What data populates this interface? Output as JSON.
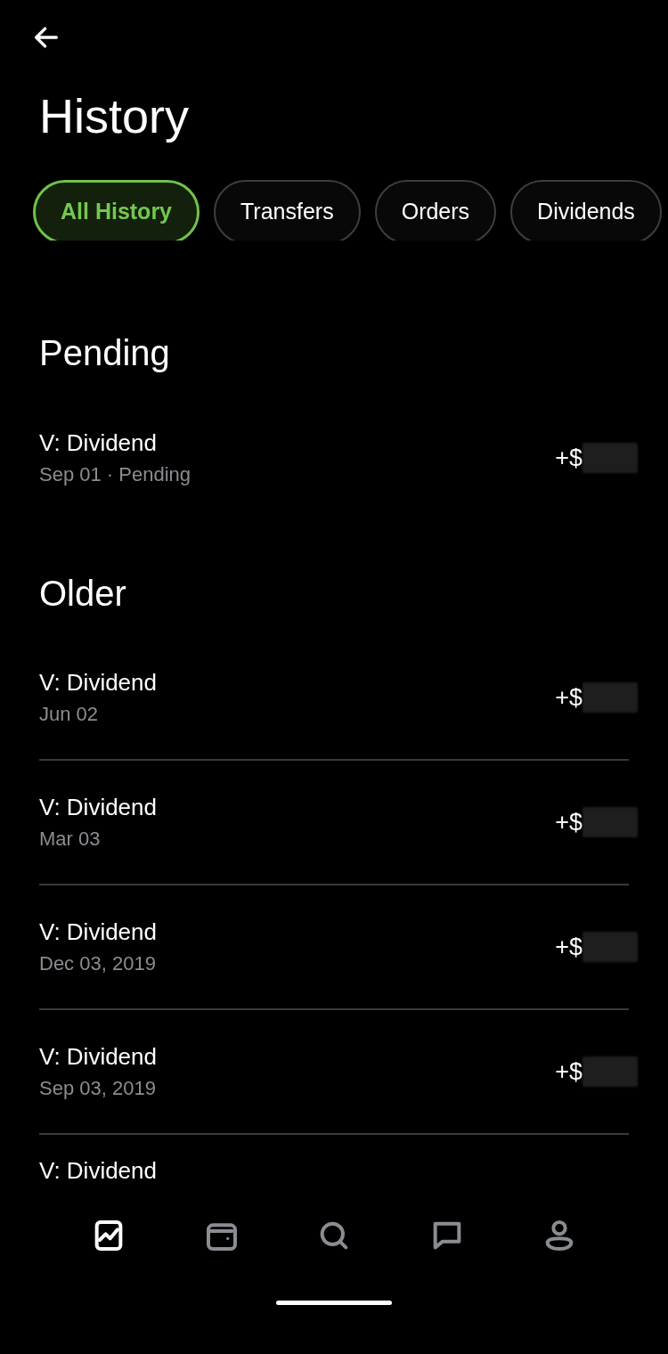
{
  "title": "History",
  "tabs": [
    {
      "label": "All History",
      "selected": true
    },
    {
      "label": "Transfers",
      "selected": false
    },
    {
      "label": "Orders",
      "selected": false
    },
    {
      "label": "Dividends",
      "selected": false
    }
  ],
  "sections": [
    {
      "heading": "Pending",
      "items": [
        {
          "title": "V: Dividend",
          "subtitle": "Sep 01 · Pending",
          "amount": "+$"
        }
      ]
    },
    {
      "heading": "Older",
      "items": [
        {
          "title": "V: Dividend",
          "subtitle": "Jun 02",
          "amount": "+$"
        },
        {
          "title": "V: Dividend",
          "subtitle": "Mar 03",
          "amount": "+$"
        },
        {
          "title": "V: Dividend",
          "subtitle": "Dec 03, 2019",
          "amount": "+$"
        },
        {
          "title": "V: Dividend",
          "subtitle": "Sep 03, 2019",
          "amount": "+$"
        },
        {
          "title": "V: Dividend"
        }
      ]
    }
  ],
  "nav": [
    {
      "kind": "chart",
      "selected": true
    },
    {
      "kind": "wallet",
      "selected": false
    },
    {
      "kind": "search",
      "selected": false
    },
    {
      "kind": "chat",
      "selected": false
    },
    {
      "kind": "profile",
      "selected": false
    }
  ]
}
